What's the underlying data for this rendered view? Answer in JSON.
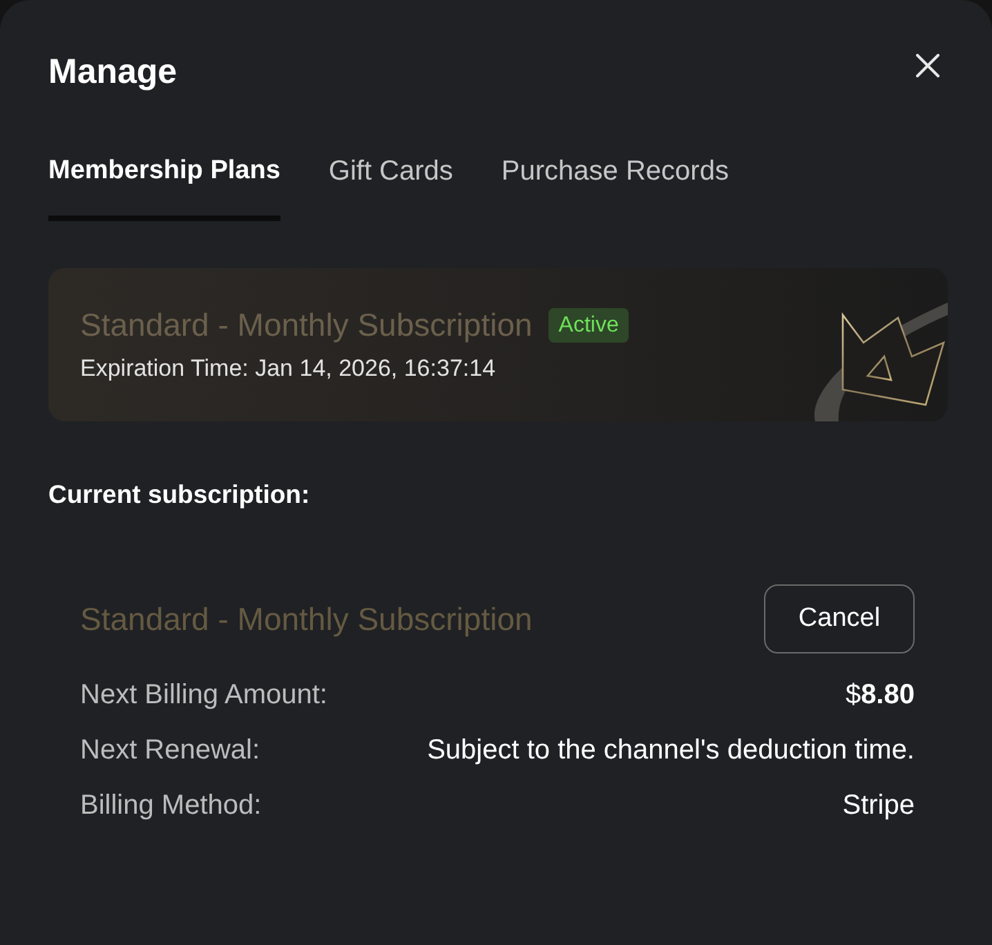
{
  "dialog": {
    "title": "Manage"
  },
  "tabs": [
    {
      "label": "Membership Plans",
      "selected": true
    },
    {
      "label": "Gift Cards",
      "selected": false
    },
    {
      "label": "Purchase Records",
      "selected": false
    }
  ],
  "plan_card": {
    "title": "Standard - Monthly Subscription",
    "badge": "Active",
    "expiration": "Expiration Time: Jan 14, 2026, 16:37:14"
  },
  "current_subscription": {
    "heading": "Current subscription:",
    "title": "Standard - Monthly Subscription",
    "cancel_button": "Cancel",
    "details": [
      {
        "label": "Next Billing Amount:",
        "value": "$**8.80**"
      },
      {
        "label": "Next Renewal:",
        "value": "Subject to the channel's deduction time."
      },
      {
        "label": "Billing Method:",
        "value": "Stripe"
      }
    ]
  }
}
